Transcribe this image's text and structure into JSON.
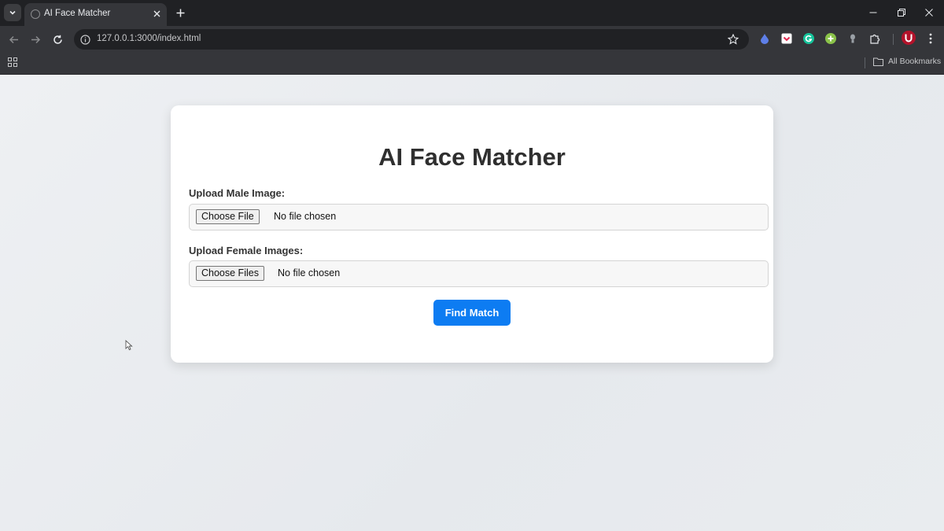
{
  "browser": {
    "tab": {
      "title": "AI Face Matcher"
    },
    "address": {
      "url": "127.0.0.1:3000/index.html"
    },
    "bookmarks": {
      "all_label": "All Bookmarks"
    }
  },
  "page": {
    "title": "AI Face Matcher",
    "male_field": {
      "label": "Upload Male Image:",
      "button_label": "Choose File",
      "status": "No file chosen"
    },
    "female_field": {
      "label": "Upload Female Images:",
      "button_label": "Choose Files",
      "status": "No file chosen"
    },
    "submit_label": "Find Match"
  },
  "icons": {
    "tab_search": "chevron-down-icon",
    "tab_close": "close-icon",
    "new_tab": "plus-icon",
    "extensions": [
      "drop-icon",
      "pocket-icon",
      "grammarly-icon",
      "plus-circle-icon",
      "lamp-icon",
      "puzzle-icon",
      "profile-icon",
      "kebab-menu-icon"
    ]
  },
  "colors": {
    "primary_button": "#0d7cf2",
    "chrome_dark": "#202124",
    "chrome_toolbar": "#35363a",
    "card": "#ffffff"
  }
}
